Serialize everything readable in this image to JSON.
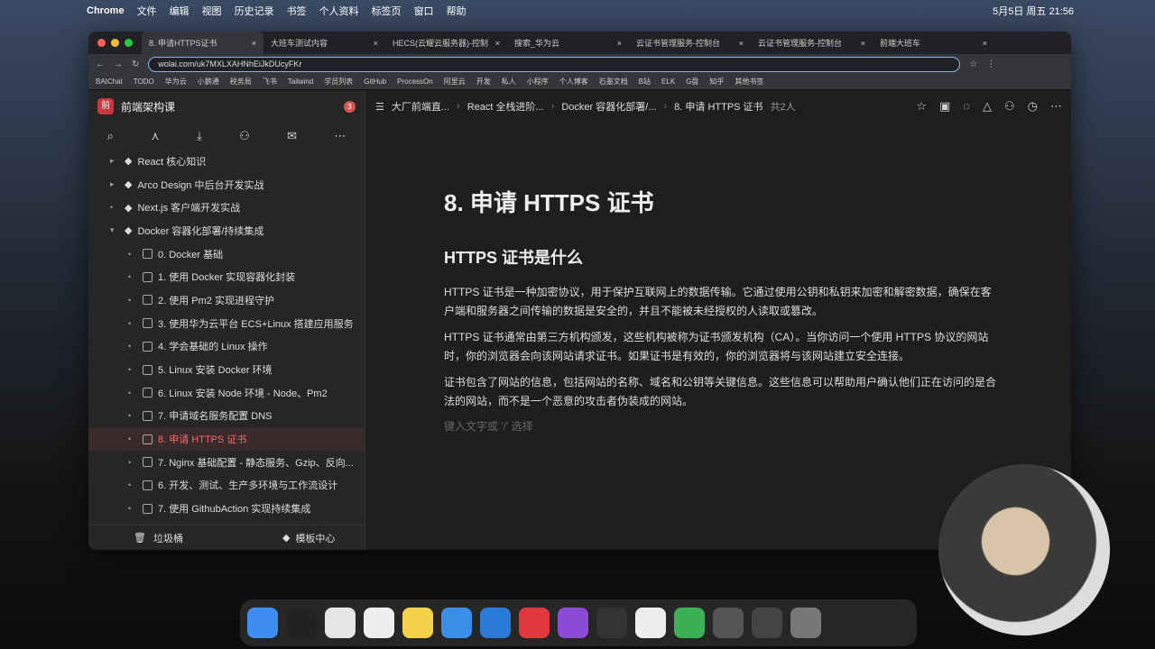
{
  "menubar": {
    "items": [
      "Chrome",
      "文件",
      "编辑",
      "视图",
      "历史记录",
      "书签",
      "个人资料",
      "标签页",
      "窗口",
      "帮助"
    ],
    "clock": "5月5日 周五 21:56"
  },
  "tabs": [
    "8. 申请HTTPS证书",
    "大班车测试内容",
    "HECS(云耀云服务器)-控制",
    "搜索_华为云",
    "云证书管理服务-控制台",
    "云证书管理服务-控制台",
    "前端大班车"
  ],
  "url": "wolai.com/uk7MXLXAHNhEiJkDUcyFKr",
  "bookmarks": [
    "BAIChat",
    "TODO",
    "华为云",
    "小鹅通",
    "税务局",
    "飞书",
    "Tailwind",
    "学员列表",
    "GitHub",
    "ProcessOn",
    "阿里云",
    "开发",
    "私人",
    "小程序",
    "个人博客",
    "石墨文档",
    "B站",
    "ELK",
    "G盘",
    "知乎",
    "其他书签"
  ],
  "sidebar": {
    "workspace": "前端架构课",
    "badge": "3",
    "items": [
      {
        "label": "React 核心知识",
        "level": 0,
        "caret": "▸"
      },
      {
        "label": "Arco Design 中后台开发实战",
        "level": 0,
        "caret": "▸"
      },
      {
        "label": "Next.js 客户端开发实战",
        "level": 0,
        "caret": "•"
      },
      {
        "label": "Docker 容器化部署/持续集成",
        "level": 0,
        "caret": "▾"
      },
      {
        "label": "0. Docker 基础",
        "level": 1
      },
      {
        "label": "1. 使用 Docker 实现容器化封装",
        "level": 1
      },
      {
        "label": "2. 使用 Pm2 实现进程守护",
        "level": 1
      },
      {
        "label": "3. 使用华为云平台 ECS+Linux 搭建应用服务",
        "level": 1
      },
      {
        "label": "4. 学会基础的 Linux 操作",
        "level": 1
      },
      {
        "label": "5. Linux 安装 Docker 环境",
        "level": 1
      },
      {
        "label": "6. Linux 安装 Node 环境 - Node、Pm2",
        "level": 1
      },
      {
        "label": "7. 申请域名服务配置 DNS",
        "level": 1
      },
      {
        "label": "8. 申请 HTTPS 证书",
        "level": 1,
        "selected": true
      },
      {
        "label": "7. Nginx 基础配置 - 静态服务、Gzip、反向...",
        "level": 1
      },
      {
        "label": "6. 开发、测试、生产多环境与工作流设计",
        "level": 1
      },
      {
        "label": "7. 使用 GithubAction 实现持续集成",
        "level": 1
      }
    ],
    "trash": "垃圾桶",
    "templates": "模板中心"
  },
  "breadcrumb": [
    "大厂前端直...",
    "React 全栈进阶...",
    "Docker 容器化部署/...",
    "8. 申请 HTTPS 证书"
  ],
  "collab": "共2人",
  "doc": {
    "title": "8. 申请 HTTPS 证书",
    "h2": "HTTPS 证书是什么",
    "paragraphs": [
      "HTTPS 证书是一种加密协议，用于保护互联网上的数据传输。它通过使用公钥和私钥来加密和解密数据，确保在客户端和服务器之间传输的数据是安全的，并且不能被未经授权的人读取或篡改。",
      "HTTPS 证书通常由第三方机构颁发，这些机构被称为证书颁发机构（CA）。当你访问一个使用 HTTPS 协议的网站时，你的浏览器会向该网站请求证书。如果证书是有效的，你的浏览器将与该网站建立安全连接。",
      "证书包含了网站的信息，包括网站的名称、域名和公钥等关键信息。这些信息可以帮助用户确认他们正在访问的是合法的网站，而不是一个恶意的攻击者伪装成的网站。"
    ],
    "placeholder": "键入文字或 '/' 选择"
  }
}
